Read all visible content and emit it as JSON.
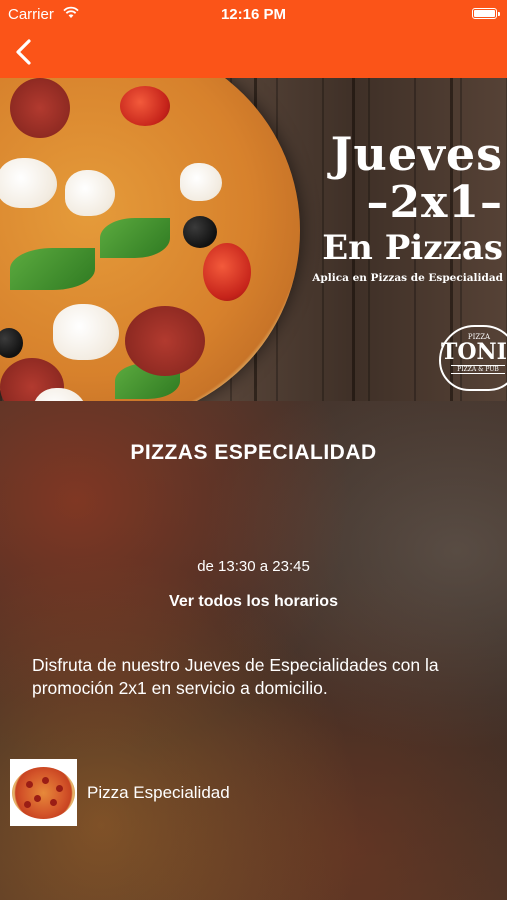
{
  "status_bar": {
    "carrier": "Carrier",
    "time": "12:16 PM"
  },
  "nav": {
    "back_icon": "chevron-left-icon"
  },
  "banner": {
    "promo_line1": "Jueves",
    "promo_line2": "–2x1–",
    "promo_line3": "En Pizzas",
    "promo_sub": "Aplica en Pizzas de Especialidad",
    "logo_top": "PIZZA",
    "logo_name": "TONIC",
    "logo_sub": "PIZZA & PUB"
  },
  "content": {
    "title": "PIZZAS ESPECIALIDAD",
    "hours": "de 13:30 a 23:45",
    "all_hours_link": "Ver todos los horarios",
    "description": "Disfruta de nuestro Jueves de Especialidades con la promoción 2x1 en servicio a domicilio.",
    "product": {
      "name": "Pizza Especialidad"
    }
  },
  "colors": {
    "accent": "#fb5418"
  }
}
